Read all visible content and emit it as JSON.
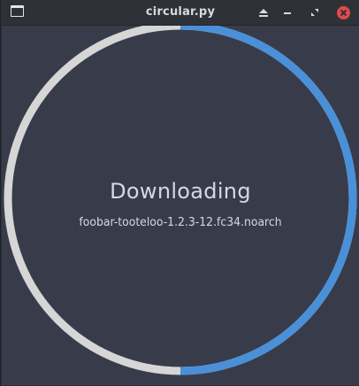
{
  "window": {
    "title": "circular.py"
  },
  "titlebar": {
    "icons": {
      "app": "window-icon",
      "shade": "eject-icon",
      "minimize": "minimize-icon",
      "maximize": "maximize-icon",
      "close": "close-icon"
    }
  },
  "progress": {
    "status": "Downloading",
    "package": "foobar-tooteloo-1.2.3-12.fc34.noarch",
    "fraction": 0.5,
    "colors": {
      "filled": "#4a90d9",
      "track": "#d6d6d6",
      "background": "#383c4a"
    }
  }
}
